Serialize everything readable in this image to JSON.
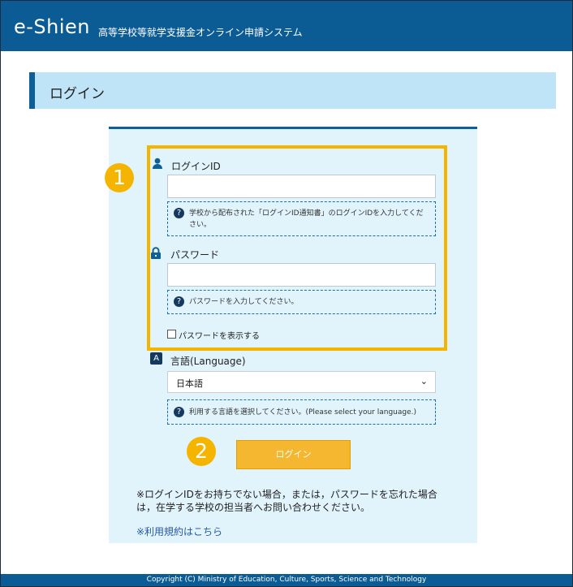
{
  "header": {
    "brand": "e-Shien",
    "subtitle": "高等学校等就学支援金オンライン申請システム"
  },
  "page": {
    "title": "ログイン"
  },
  "login_form": {
    "login_id": {
      "label": "ログインID",
      "value": "",
      "help": "学校から配布された「ログインID通知書」のログインIDを入力してください。"
    },
    "password": {
      "label": "パスワード",
      "value": "",
      "help": "パスワードを入力してください。"
    },
    "show_password": {
      "label": "パスワードを表示する",
      "checked": false
    },
    "language": {
      "label": "言語(Language)",
      "selected": "日本語",
      "help": "利用する言語を選択してください。(Please select your language.)"
    },
    "submit_label": "ログイン"
  },
  "notice": {
    "text": "※ログインIDをお持ちでない場合，または，パスワードを忘れた場合は，在学する学校の担当者へお問い合わせください。",
    "terms_link": "※利用規約はこちら"
  },
  "annotations": {
    "badge_1": "1",
    "badge_2": "2"
  },
  "footer": {
    "copyright": "Copyright (C) Ministry of Education, Culture, Sports, Science and Technology"
  },
  "icons": {
    "user": "user-icon",
    "password": "lock-icon",
    "language": "language-icon",
    "help": "help-icon",
    "chevron": "chevron-down-icon"
  },
  "colors": {
    "header": "#0b5b94",
    "panel": "#e1f3fb",
    "highlight": "#f5b400",
    "button": "#f5b730"
  }
}
